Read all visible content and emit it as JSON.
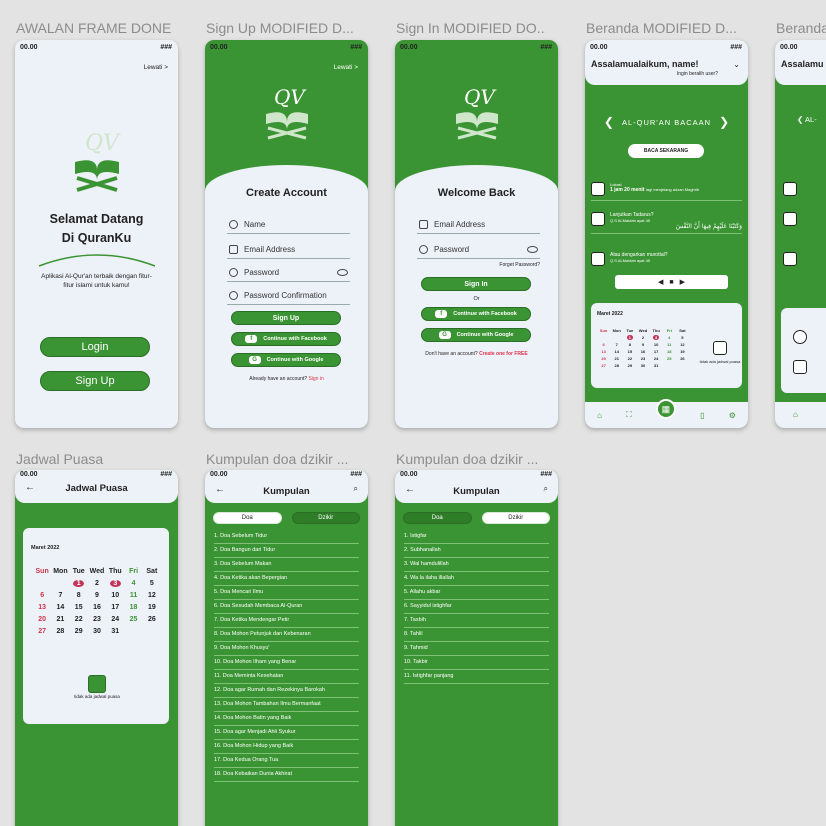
{
  "frame_labels": [
    "AWALAN FRAME DONE",
    "Sign Up MODIFIED D...",
    "Sign In MODIFIED DO...",
    "Beranda MODIFIED D...",
    "Beranda",
    "Jadwal Puasa",
    "Kumpulan doa dzikir ...",
    "Kumpulan doa dzikir ..."
  ],
  "status": {
    "time": "00.00",
    "signal": "###"
  },
  "splash": {
    "skip": "Lewati >",
    "title": "Selamat Datang\nDi QuranKu",
    "subtitle": "Aplikasi Al-Qur'an terbaik dengan fitur-fitur islami untuk kamu!",
    "login": "Login",
    "signup": "Sign Up"
  },
  "signup": {
    "skip": "Lewati >",
    "title": "Create Account",
    "fields": [
      "Name",
      "Email Address",
      "Password",
      "Password Confirmation"
    ],
    "button": "Sign Up",
    "facebook": "Continue with Facebook",
    "google": "Continue with Google",
    "footer": "Already have an account?",
    "footer_link": "Sign in"
  },
  "signin": {
    "title": "Welcome Back",
    "fields": [
      "Email Address",
      "Password"
    ],
    "forgot": "Forget Password?",
    "button": "Sign In",
    "or": "Or",
    "facebook": "Continue with Facebook",
    "google": "Continue with Google",
    "footer": "Don't have an account?",
    "footer_link": "Create one for FREE"
  },
  "beranda": {
    "greet": "Assalamualaikum, name!",
    "switch": "Ingin beralih user?",
    "banner": "AL-QUR'AN BACAAN",
    "read_now": "BACA SEKARANG",
    "loc": "Lokasi",
    "time_left": "1 jam 20 menit",
    "time_tail": "lagi menjelang adzan Maghrib",
    "continue_title": "Lanjutkan Tadarus?",
    "continue_sub": "Q.S Al-Maidah ayat 45",
    "arabic": "وَكَتَبْنَا عَلَيْهِمْ فِيهَا أَنَّ النَّفْسَ",
    "listen_title": "Atau dengarkan murottal?",
    "listen_sub": "Q.S Al-Maidah ayat 45",
    "month": "Maret 2022",
    "no_fast": "tidak ada jadwal puasa",
    "greet2": "Assalamu",
    "banner2": "AL-"
  },
  "calendar": {
    "days": [
      "Sun",
      "Mon",
      "Tue",
      "Wed",
      "Thu",
      "Fri",
      "Sat"
    ],
    "cells": [
      "",
      "",
      "1",
      "2",
      "3",
      "4",
      "5",
      "6",
      "7",
      "8",
      "9",
      "10",
      "11",
      "12",
      "13",
      "14",
      "15",
      "16",
      "17",
      "18",
      "19",
      "20",
      "21",
      "22",
      "23",
      "24",
      "25",
      "26",
      "27",
      "28",
      "29",
      "30",
      "31",
      "",
      ""
    ],
    "colors": {
      "sun": "#d0344b",
      "fri": "#3b9433",
      "mark": "#c2345a"
    }
  },
  "jadwal": {
    "title": "Jadwal Puasa",
    "month": "Maret 2022",
    "no_fast": "tidak ada jadwal puasa"
  },
  "doa": {
    "title": "Kumpulan",
    "tab1": "Doa",
    "tab2": "Dzikir",
    "items": [
      "1. Doa Sebelum Tidur",
      "2. Doa Bangun dari Tidur",
      "3. Doa Sebelum Makan",
      "4. Doa Ketika akan Bepergian",
      "5. Doa  Mencari Ilmu",
      "6. Doa Sesudah Membaca Al-Quran",
      "7. Doa Ketika Mendengar Petir",
      "8. Doa Mohon Petunjuk dan Kebenaran",
      "9. Doa  Mohon Khusyu'",
      "10. Doa Mohon Ilham yang Benar",
      "11. Doa Meminta Kesehatan",
      "12. Doa agar Rumah dan Rezekinya Barokah",
      "13. Doa Mohon Tambahan Ilmu Bermanfaat",
      "14. Doa Mohon Batin yang Baik",
      "15. Doa agar Menjadi Ahli Syukur",
      "16. Doa Mohon Hidup yang Baik",
      "17. Doa Kedua Orang Tua",
      "18. Doa Kebaikan Dunia Akhirat"
    ]
  },
  "dzikir": {
    "title": "Kumpulan",
    "tab1": "Doa",
    "tab2": "Dzikir",
    "items": [
      "1. Istigfar",
      "2. Subhanallah",
      "3. Wal hamdulillah",
      "4. Wa la ilaha illallah",
      "5. Allahu akbar",
      "6. Sayyidul istighfar",
      "7. Tasbih",
      "8. Tahlil",
      "9. Tahmid",
      "10. Takbir",
      "11. Istighfar panjang"
    ]
  }
}
